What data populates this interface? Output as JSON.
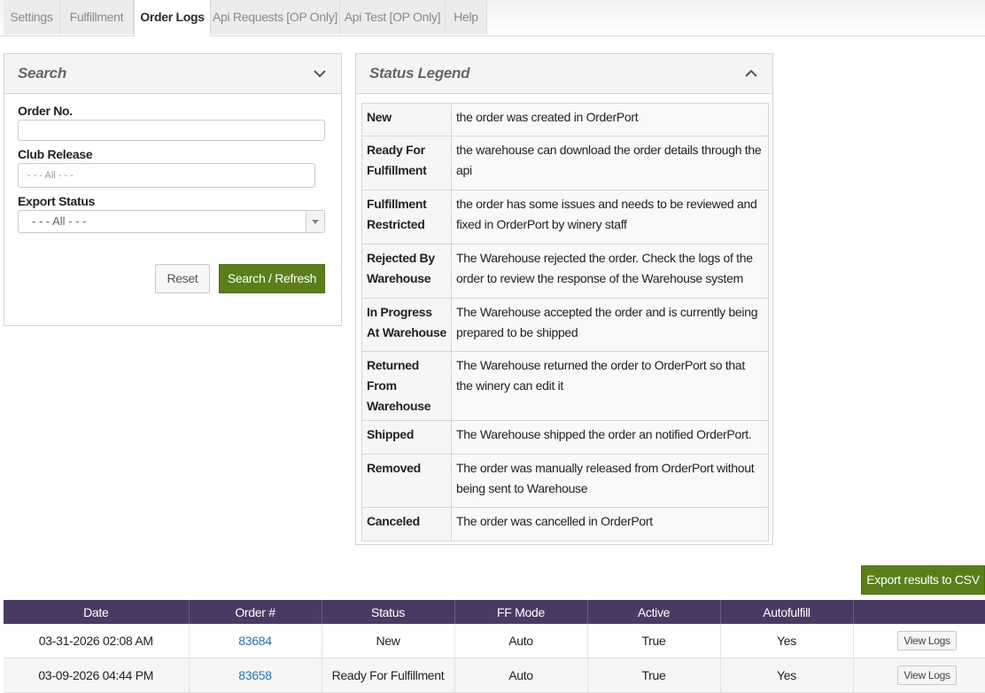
{
  "tabs": [
    {
      "label": "Settings"
    },
    {
      "label": "Fulfillment"
    },
    {
      "label": "Order Logs"
    },
    {
      "label": "Api Requests [OP Only]"
    },
    {
      "label": "Api Test [OP Only]"
    },
    {
      "label": "Help"
    }
  ],
  "search": {
    "title": "Search",
    "order_no_label": "Order No.",
    "order_no_value": "",
    "club_release_label": "Club Release",
    "club_release_placeholder": "- - - All - - -",
    "export_status_label": "Export Status",
    "export_status_value": "- - - All - - -",
    "reset_label": "Reset",
    "search_label": "Search / Refresh"
  },
  "legend": {
    "title": "Status Legend",
    "rows": [
      {
        "key": "New",
        "desc": "the order was created in OrderPort"
      },
      {
        "key": "Ready For Fulfillment",
        "desc": "the warehouse can download the order details through the api"
      },
      {
        "key": "Fulfillment Restricted",
        "desc": "the order has some issues and needs to be reviewed and fixed in OrderPort by winery staff"
      },
      {
        "key": "Rejected By Warehouse",
        "desc": "The Warehouse rejected the order. Check the logs of the order to review the response of the Warehouse system"
      },
      {
        "key": "In Progress At Warehouse",
        "desc": "The Warehouse accepted the order and is currently being prepared to be shipped"
      },
      {
        "key": "Returned From Warehouse",
        "desc": "The Warehouse returned the order to OrderPort so that the winery can edit it"
      },
      {
        "key": "Shipped",
        "desc": "The Warehouse shipped the order an notified OrderPort."
      },
      {
        "key": "Removed",
        "desc": "The order was manually released from OrderPort without being sent to Warehouse"
      },
      {
        "key": "Canceled",
        "desc": "The order was cancelled in OrderPort"
      }
    ]
  },
  "export_label": "Export results to CSV",
  "results": {
    "headers": [
      "Date",
      "Order #",
      "Status",
      "FF Mode",
      "Active",
      "Autofulfill",
      ""
    ],
    "rows": [
      {
        "date": "03-31-2026 02:08 AM",
        "order": "83684",
        "status": "New",
        "ff_mode": "Auto",
        "active": "True",
        "autofulfill": "Yes",
        "action": "View Logs"
      },
      {
        "date": "03-09-2026 04:44 PM",
        "order": "83658",
        "status": "Ready For Fulfillment",
        "ff_mode": "Auto",
        "active": "True",
        "autofulfill": "Yes",
        "action": "View Logs"
      }
    ]
  },
  "colors": {
    "accent_green": "#5b7e1a",
    "table_header": "#4a3a63",
    "link": "#2a73b0"
  }
}
